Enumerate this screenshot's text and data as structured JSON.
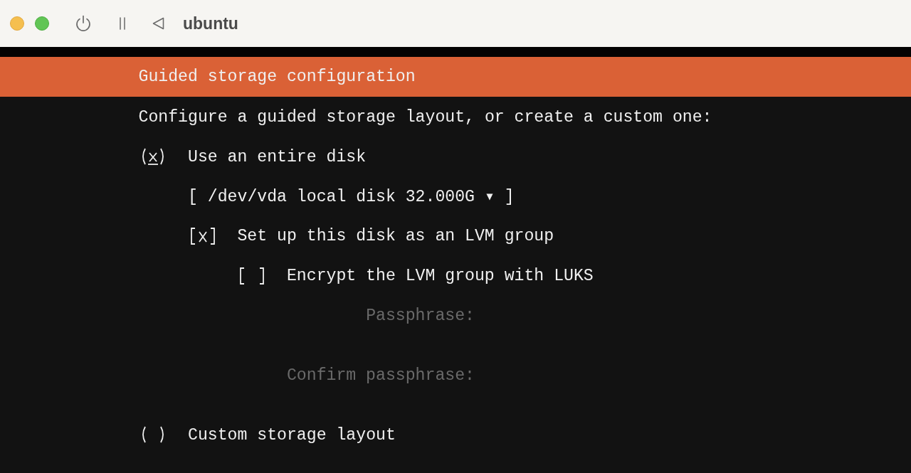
{
  "window": {
    "title": "ubuntu"
  },
  "screen": {
    "header": "Guided storage configuration",
    "prompt": "Configure a guided storage layout, or create a custom one:",
    "options": [
      {
        "kind": "radio",
        "label": "Use an entire disk",
        "selected": true,
        "focused": true,
        "children": [
          {
            "kind": "dropdown",
            "text": "[ /dev/vda local disk 32.000G ▾ ]"
          },
          {
            "kind": "checkbox",
            "label": "Set up this disk as an LVM group",
            "checked": true,
            "focused": false,
            "children": [
              {
                "kind": "checkbox",
                "label": "Encrypt the LVM group with LUKS",
                "checked": false,
                "focused": false,
                "children": [
                  {
                    "kind": "password",
                    "label": "Passphrase:",
                    "disabled": true
                  },
                  {
                    "kind": "password",
                    "label": "Confirm passphrase:",
                    "disabled": true
                  }
                ]
              }
            ]
          }
        ]
      },
      {
        "kind": "radio",
        "label": "Custom storage layout",
        "selected": false,
        "focused": false
      }
    ]
  }
}
